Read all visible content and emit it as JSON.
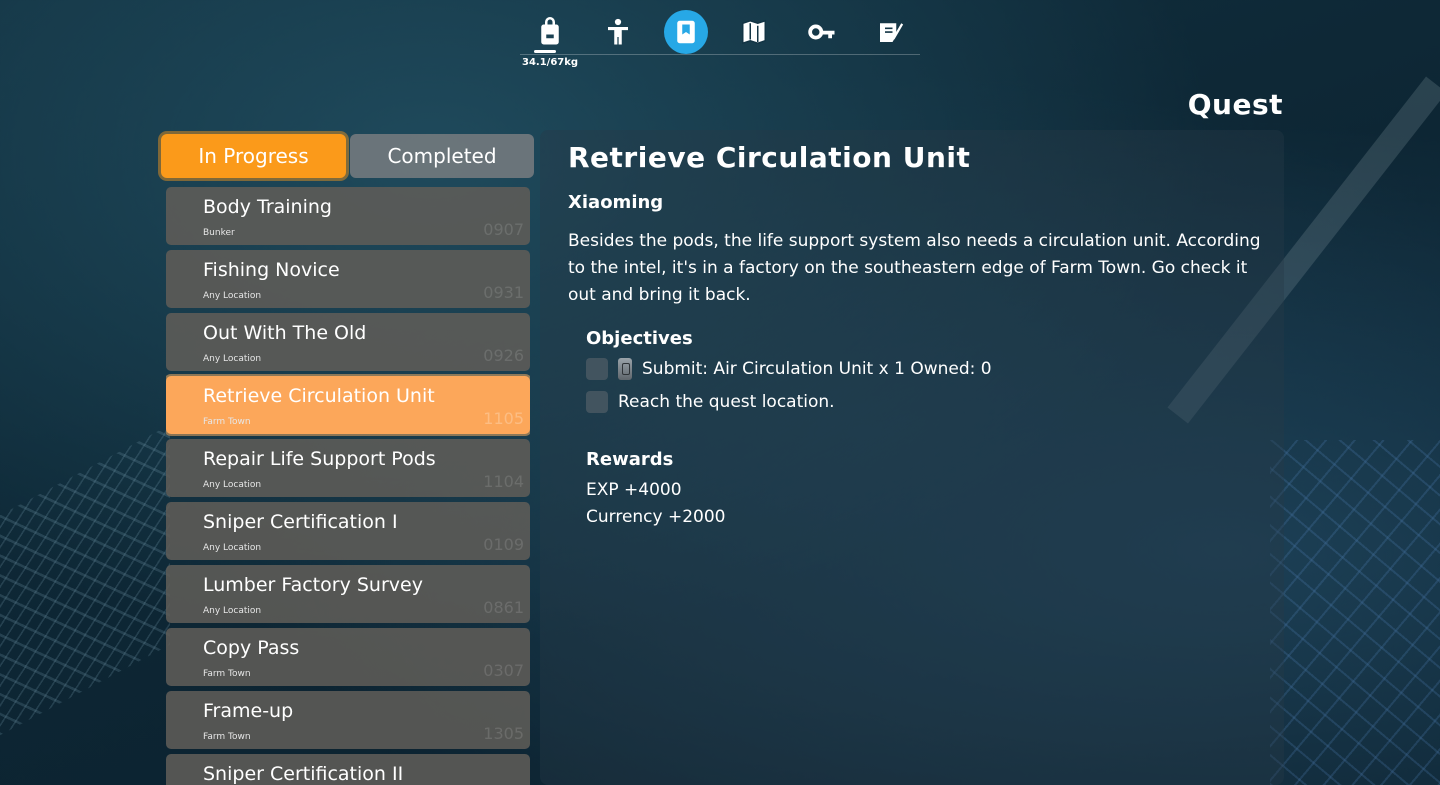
{
  "nav": {
    "weight": "34.1/67kg",
    "icons": [
      "backpack-icon",
      "character-icon",
      "quest-bookmark-icon",
      "map-icon",
      "key-icon",
      "notes-icon"
    ],
    "active_color": "#27a8e6"
  },
  "page_title": "Quest",
  "tabs": {
    "in_progress": "In Progress",
    "completed": "Completed",
    "active_color": "#fb9a1a"
  },
  "quests": [
    {
      "name": "Body Training",
      "location": "Bunker",
      "id": "0907"
    },
    {
      "name": "Fishing Novice",
      "location": "Any Location",
      "id": "0931"
    },
    {
      "name": "Out With The Old",
      "location": "Any Location",
      "id": "0926"
    },
    {
      "name": "Retrieve Circulation Unit",
      "location": "Farm Town",
      "id": "1105"
    },
    {
      "name": "Repair Life Support Pods",
      "location": "Any Location",
      "id": "1104"
    },
    {
      "name": "Sniper Certification I",
      "location": "Any Location",
      "id": "0109"
    },
    {
      "name": "Lumber Factory Survey",
      "location": "Any Location",
      "id": "0861"
    },
    {
      "name": "Copy Pass",
      "location": "Farm Town",
      "id": "0307"
    },
    {
      "name": "Frame-up",
      "location": "Farm Town",
      "id": "1305"
    },
    {
      "name": "Sniper Certification II",
      "location": "",
      "id": ""
    }
  ],
  "detail": {
    "title": "Retrieve Circulation Unit",
    "giver": "Xiaoming",
    "description": "Besides the pods, the life support system also needs a circulation unit. According to the intel, it's in a factory on the southeastern edge of Farm Town. Go check it out and bring it back.",
    "objectives_label": "Objectives",
    "objectives": [
      "Submit: Air Circulation Unit x 1 Owned: 0",
      "Reach the quest location."
    ],
    "rewards_label": "Rewards",
    "rewards": [
      "EXP +4000",
      "Currency +2000"
    ]
  }
}
